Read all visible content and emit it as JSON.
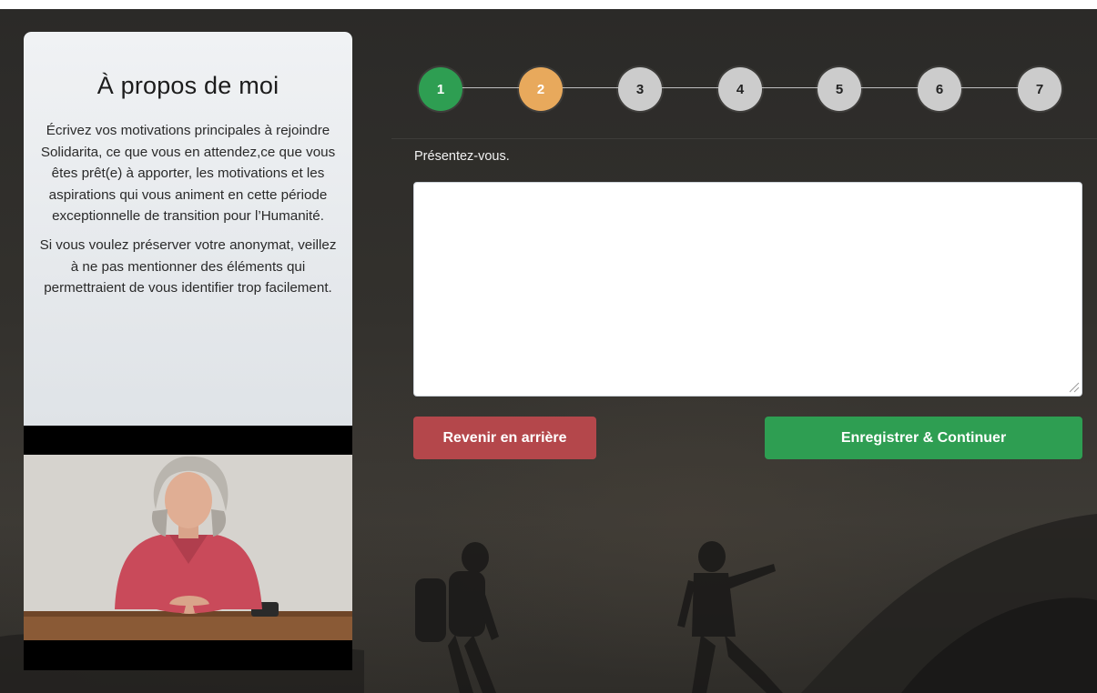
{
  "sidebar": {
    "title": "À propos de moi",
    "paragraph1": "Écrivez vos motivations principales à rejoindre Solidarita, ce que vous en attendez,ce que vous êtes prêt(e) à apporter, les motivations et les aspirations qui vous animent en cette période exceptionnelle de transition pour l’Humanité.",
    "paragraph2": "Si vous voulez préserver votre anonymat, veillez à ne pas mentionner des éléments qui permettraient de vous identifier trop facilement."
  },
  "stepper": {
    "steps": [
      {
        "label": "1",
        "state": "done"
      },
      {
        "label": "2",
        "state": "current"
      },
      {
        "label": "3",
        "state": "pending"
      },
      {
        "label": "4",
        "state": "pending"
      },
      {
        "label": "5",
        "state": "pending"
      },
      {
        "label": "6",
        "state": "pending"
      },
      {
        "label": "7",
        "state": "pending"
      }
    ],
    "colors": {
      "done": "#2e9e52",
      "current": "#e8a95c",
      "pending": "#cccccc"
    }
  },
  "form": {
    "label": "Présentez-vous.",
    "value": "",
    "placeholder": ""
  },
  "buttons": {
    "back_label": "Revenir en arrière",
    "next_label": "Enregistrer & Continuer",
    "back_color": "#b4474b",
    "next_color": "#2e9e52"
  }
}
